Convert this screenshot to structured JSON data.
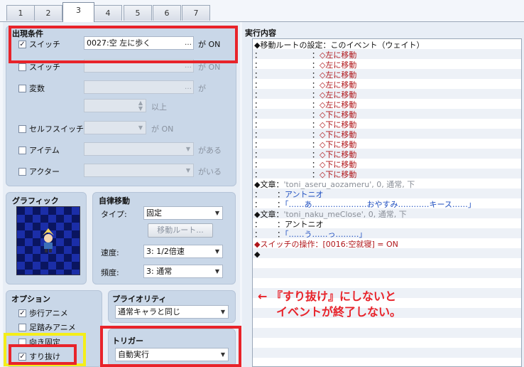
{
  "tabs": [
    "1",
    "2",
    "3",
    "4",
    "5",
    "6",
    "7"
  ],
  "conditions": {
    "title": "出現条件",
    "switch1": {
      "label": "スイッチ",
      "value": "0027:空 左に歩く",
      "suffix": "が ON"
    },
    "switch2": {
      "label": "スイッチ",
      "suffix": "が ON"
    },
    "variable": {
      "label": "変数",
      "suffix": "が",
      "suffix2": "以上"
    },
    "self_switch": {
      "label": "セルフスイッチ",
      "suffix": "が ON"
    },
    "item": {
      "label": "アイテム",
      "suffix": "がある"
    },
    "actor": {
      "label": "アクター",
      "suffix": "がいる"
    }
  },
  "graphic": {
    "title": "グラフィック"
  },
  "autonomous": {
    "title": "自律移動",
    "type_label": "タイプ:",
    "type_value": "固定",
    "route_button": "移動ルート...",
    "speed_label": "速度:",
    "speed_value": "3: 1/2倍速",
    "freq_label": "頻度:",
    "freq_value": "3: 通常"
  },
  "options": {
    "title": "オプション",
    "walk_anime": "歩行アニメ",
    "step_anime": "足踏みアニメ",
    "direction_fix": "向き固定",
    "through": "すり抜け"
  },
  "priority": {
    "title": "プライオリティ",
    "value": "通常キャラと同じ"
  },
  "trigger": {
    "title": "トリガー",
    "value": "自動実行"
  },
  "content": {
    "title": "実行内容",
    "lines": [
      {
        "a": "◆移動ルートの設定：",
        "b": "このイベント（ウェイト）",
        "cls": ""
      },
      {
        "a": "：                    ：",
        "b": "◇左に移動",
        "cls": "c-red"
      },
      {
        "a": "：                    ：",
        "b": "◇左に移動",
        "cls": "c-red"
      },
      {
        "a": "：                    ：",
        "b": "◇左に移動",
        "cls": "c-red"
      },
      {
        "a": "：                    ：",
        "b": "◇左に移動",
        "cls": "c-red"
      },
      {
        "a": "：                    ：",
        "b": "◇左に移動",
        "cls": "c-red"
      },
      {
        "a": "：                    ：",
        "b": "◇左に移動",
        "cls": "c-red"
      },
      {
        "a": "：                    ：",
        "b": "◇下に移動",
        "cls": "c-red"
      },
      {
        "a": "：                    ：",
        "b": "◇下に移動",
        "cls": "c-red"
      },
      {
        "a": "：                    ：",
        "b": "◇下に移動",
        "cls": "c-red"
      },
      {
        "a": "：                    ：",
        "b": "◇下に移動",
        "cls": "c-red"
      },
      {
        "a": "：                    ：",
        "b": "◇下に移動",
        "cls": "c-red"
      },
      {
        "a": "：                    ：",
        "b": "◇下に移動",
        "cls": "c-red"
      },
      {
        "a": "：                    ：",
        "b": "◇下に移動",
        "cls": "c-red"
      },
      {
        "a": "◆文章：",
        "b": "'toni_aseru_aozameru', 0, 通常, 下",
        "cls": "c-gray"
      },
      {
        "a": "：      ：",
        "b": "アントニオ",
        "cls": "c-blue"
      },
      {
        "a": "：      ：",
        "b": "「……あ…………………おやすみ…………キース……」",
        "cls": "c-blue"
      },
      {
        "a": "◆文章：",
        "b": "'toni_naku_meClose', 0, 通常, 下",
        "cls": "c-gray"
      },
      {
        "a": "：      ：",
        "b": "アントニオ",
        "cls": ""
      },
      {
        "a": "：      ：",
        "b": "「……う……っ………」",
        "cls": "c-blue"
      },
      {
        "a": "◆スイッチの操作：",
        "b": "[0016:空就寝] = ON",
        "cls": "c-red"
      },
      {
        "a": "◆",
        "b": "",
        "cls": ""
      }
    ]
  },
  "annotation": {
    "line1": "← 『すり抜け』にしないと",
    "line2": "イベントが終了しない。"
  }
}
